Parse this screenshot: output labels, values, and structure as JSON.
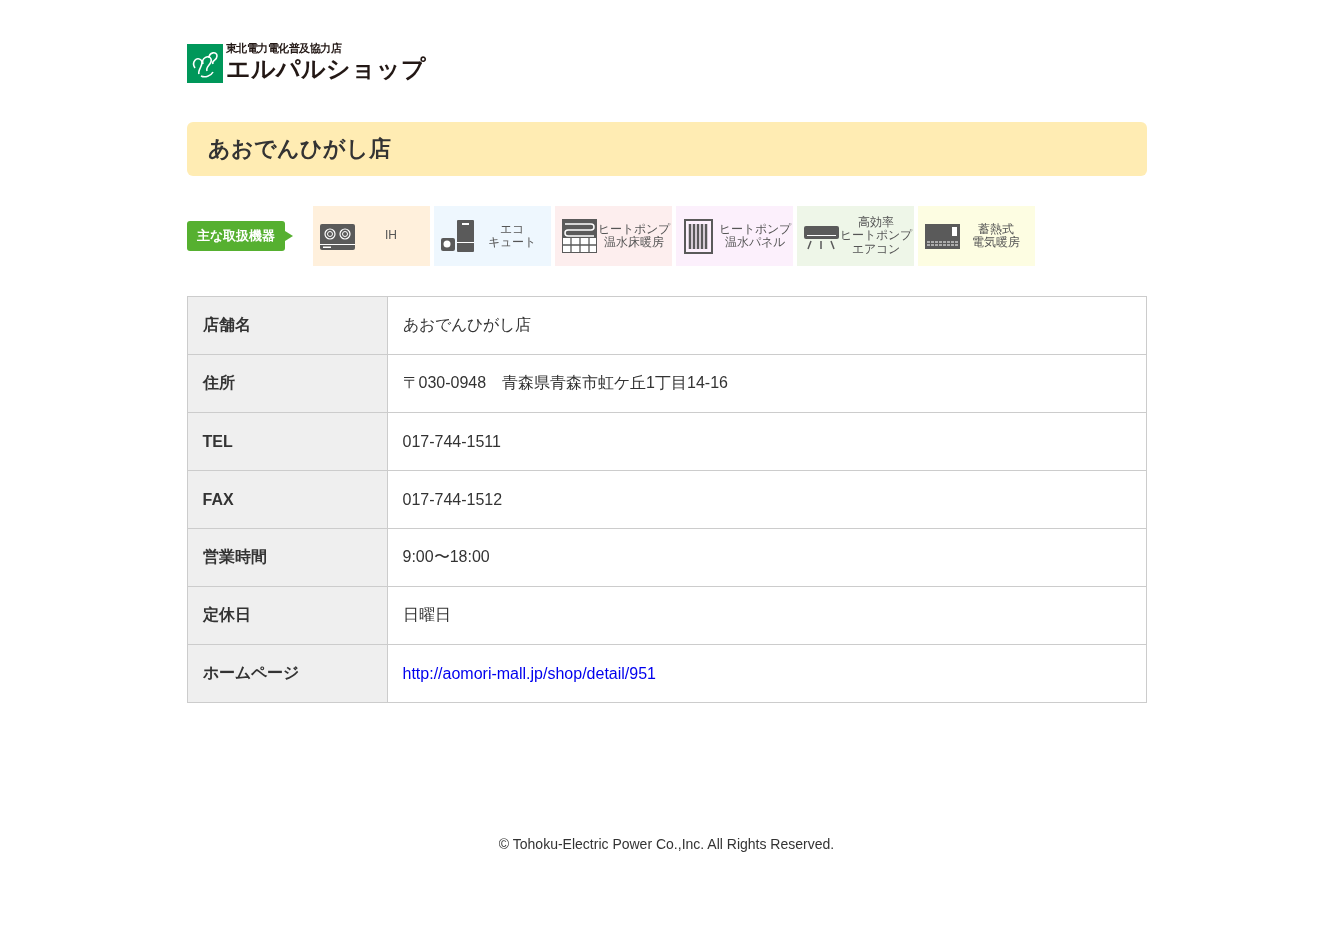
{
  "logo": {
    "tagline": "東北電力電化普及協力店",
    "name": "エルパルショップ"
  },
  "title": "あおでんひがし店",
  "equipment": {
    "label": "主な取扱機器",
    "items": [
      {
        "kind": "ih",
        "lines": [
          "IH"
        ],
        "color": "#fff0dc"
      },
      {
        "kind": "ecocute",
        "lines": [
          "エコ",
          "キュート"
        ],
        "color": "#eef7fe"
      },
      {
        "kind": "floor",
        "lines": [
          "ヒートポンプ",
          "温水床暖房"
        ],
        "color": "#fdeeee"
      },
      {
        "kind": "panel",
        "lines": [
          "ヒートポンプ",
          "温水パネル"
        ],
        "color": "#fcf0fc"
      },
      {
        "kind": "aircon",
        "lines": [
          "高効率",
          "ヒートポンプ",
          "エアコン"
        ],
        "color": "#eef6e8"
      },
      {
        "kind": "storage",
        "lines": [
          "蓄熱式",
          "電気暖房"
        ],
        "color": "#fdfde2"
      }
    ]
  },
  "info": [
    {
      "label": "店舗名",
      "value": "あおでんひがし店"
    },
    {
      "label": "住所",
      "value": "〒030-0948　青森県青森市虹ケ丘1丁目14-16"
    },
    {
      "label": "TEL",
      "value": "017-744-1511"
    },
    {
      "label": "FAX",
      "value": "017-744-1512"
    },
    {
      "label": "営業時間",
      "value": "9:00〜18:00"
    },
    {
      "label": "定休日",
      "value": "日曜日"
    },
    {
      "label": "ホームページ",
      "value": "http://aomori-mall.jp/shop/detail/951",
      "kind": "link"
    }
  ],
  "footer": "© Tohoku-Electric Power Co.,Inc. All Rights Reserved."
}
